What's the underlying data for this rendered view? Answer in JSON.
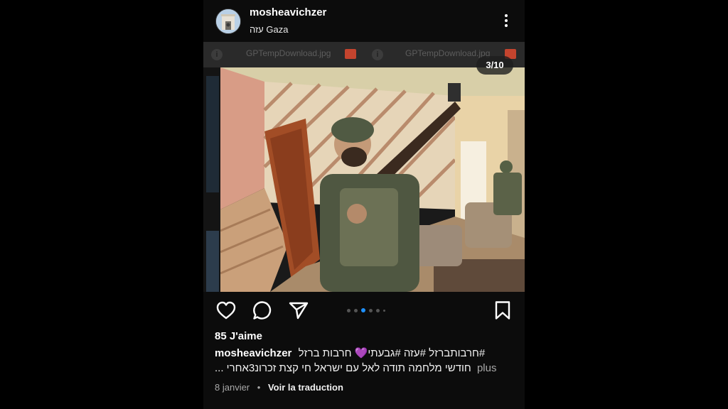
{
  "post": {
    "username": "mosheavichzer",
    "location": "עזה Gaza",
    "image_counter": "3/10",
    "likes": "85 J'aime",
    "caption_user": "mosheavichzer",
    "caption_tags": "#חרבותברזל #עזה #גבעתי💜 חרבות ברזל",
    "caption_line2": "חודשי מלחמה תודה לאל עם ישראל חי קצת זכרונ3אחרי ...",
    "more_label": "plus",
    "date": "8 janvier",
    "translate_label": "Voir la traduction"
  },
  "background_tabs": {
    "file1": "GPTempDownload.jpg",
    "file2": "GPTempDownload.jpg",
    "info_glyph": "i"
  },
  "carousel": {
    "total_dots": 6,
    "active_index": 2
  },
  "icons": {
    "more": "more-vertical-icon",
    "like": "heart-icon",
    "comment": "comment-icon",
    "share": "send-icon",
    "save": "bookmark-icon"
  },
  "colors": {
    "background": "#000000",
    "panel": "#0c0c0c",
    "text": "#f5f5f5",
    "muted": "#a8a8a8",
    "active_dot": "#1e90ff"
  }
}
